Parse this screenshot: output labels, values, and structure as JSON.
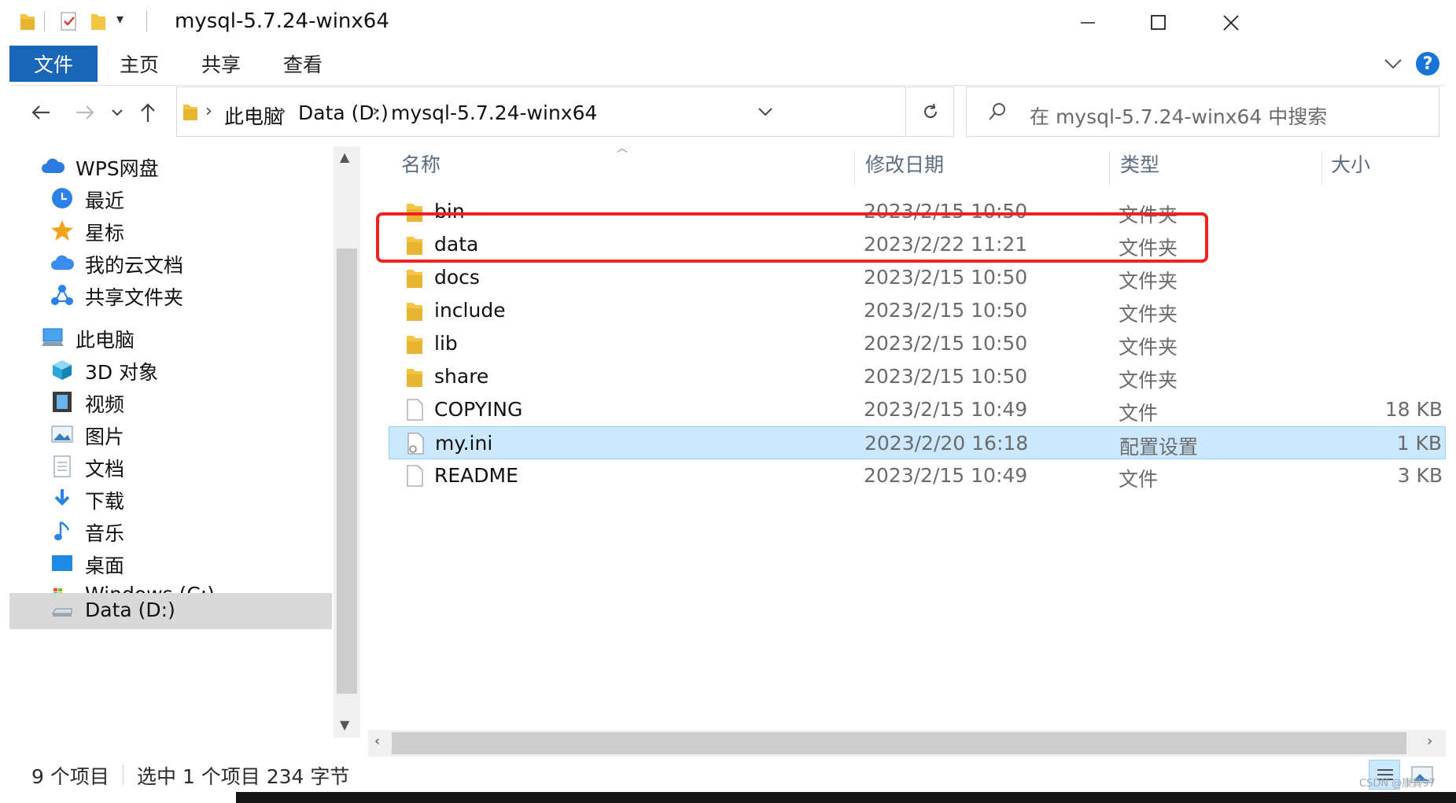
{
  "window": {
    "title": "mysql-5.7.24-winx64"
  },
  "ribbon": {
    "tabs": [
      "文件",
      "主页",
      "共享",
      "查看"
    ],
    "help_label": "?"
  },
  "address": {
    "crumbs": [
      "此电脑",
      "Data (D:)",
      "mysql-5.7.24-winx64"
    ]
  },
  "search": {
    "placeholder": "在 mysql-5.7.24-winx64 中搜索"
  },
  "sidebar": {
    "items": [
      {
        "label": "WPS网盘",
        "icon": "cloud-icon"
      },
      {
        "label": "最近",
        "icon": "clock-icon"
      },
      {
        "label": "星标",
        "icon": "star-icon"
      },
      {
        "label": "我的云文档",
        "icon": "cloud-doc-icon"
      },
      {
        "label": "共享文件夹",
        "icon": "share-icon"
      },
      {
        "label": "此电脑",
        "icon": "computer-icon"
      },
      {
        "label": "3D 对象",
        "icon": "cube-icon"
      },
      {
        "label": "视频",
        "icon": "video-icon"
      },
      {
        "label": "图片",
        "icon": "picture-icon"
      },
      {
        "label": "文档",
        "icon": "document-icon"
      },
      {
        "label": "下载",
        "icon": "download-icon"
      },
      {
        "label": "音乐",
        "icon": "music-icon"
      },
      {
        "label": "桌面",
        "icon": "desktop-icon"
      },
      {
        "label": "Windows (C:)",
        "icon": "drive-c-icon"
      },
      {
        "label": "Data (D:)",
        "icon": "drive-d-icon"
      }
    ]
  },
  "columns": {
    "name": "名称",
    "date": "修改日期",
    "type": "类型",
    "size": "大小"
  },
  "files": [
    {
      "name": "bin",
      "date": "2023/2/15 10:50",
      "type": "文件夹",
      "size": "",
      "kind": "folder"
    },
    {
      "name": "data",
      "date": "2023/2/22 11:21",
      "type": "文件夹",
      "size": "",
      "kind": "folder"
    },
    {
      "name": "docs",
      "date": "2023/2/15 10:50",
      "type": "文件夹",
      "size": "",
      "kind": "folder"
    },
    {
      "name": "include",
      "date": "2023/2/15 10:50",
      "type": "文件夹",
      "size": "",
      "kind": "folder"
    },
    {
      "name": "lib",
      "date": "2023/2/15 10:50",
      "type": "文件夹",
      "size": "",
      "kind": "folder"
    },
    {
      "name": "share",
      "date": "2023/2/15 10:50",
      "type": "文件夹",
      "size": "",
      "kind": "folder"
    },
    {
      "name": "COPYING",
      "date": "2023/2/15 10:49",
      "type": "文件",
      "size": "18 KB",
      "kind": "file"
    },
    {
      "name": "my.ini",
      "date": "2023/2/20 16:18",
      "type": "配置设置",
      "size": "1 KB",
      "kind": "ini"
    },
    {
      "name": "README",
      "date": "2023/2/15 10:49",
      "type": "文件",
      "size": "3 KB",
      "kind": "file"
    }
  ],
  "status": {
    "count": "9 个项目",
    "selection": "选中 1 个项目  234 字节"
  },
  "watermark": "CSDN @康其97",
  "colors": {
    "accent": "#1a66b8",
    "selected_row": "#cce8ff",
    "highlight": "#f0211e",
    "folder": "#f4c542"
  }
}
